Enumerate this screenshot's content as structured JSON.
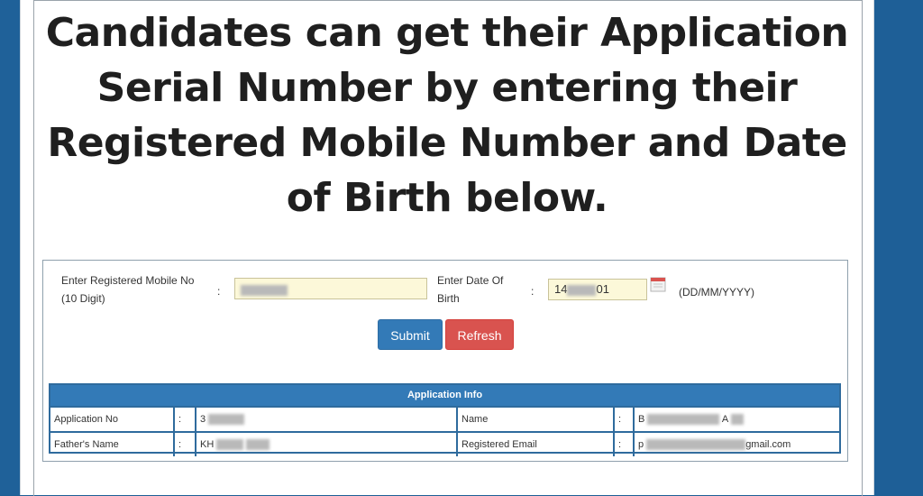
{
  "headline": "Candidates can get their Application Serial Number by entering their Registered Mobile Number and Date of Birth below.",
  "form": {
    "mobile_label_line1": "Enter Registered Mobile No",
    "mobile_label_line2": "(10 Digit)",
    "colon": ":",
    "dob_label_line1": "Enter Date Of",
    "dob_label_line2": "Birth",
    "dob_value_prefix": "14",
    "dob_value_suffix": "01",
    "dob_format_hint": "(DD/MM/YYYY)",
    "submit_label": "Submit",
    "refresh_label": "Refresh"
  },
  "info": {
    "title": "Application Info",
    "rows": [
      {
        "label_left": "Application No",
        "value_left_prefix": "3",
        "label_right": "Name",
        "value_right_prefix": "B",
        "value_right_suffix": "A"
      },
      {
        "label_left": "Father's Name",
        "value_left_prefix": "KH",
        "label_right": "Registered Email",
        "value_right_prefix": "p",
        "value_right_suffix": "gmail.com"
      }
    ]
  },
  "colors": {
    "primary": "#337ab7",
    "danger": "#d9534f",
    "field_bg": "#fcf8d9",
    "frame": "#1d5f95"
  }
}
